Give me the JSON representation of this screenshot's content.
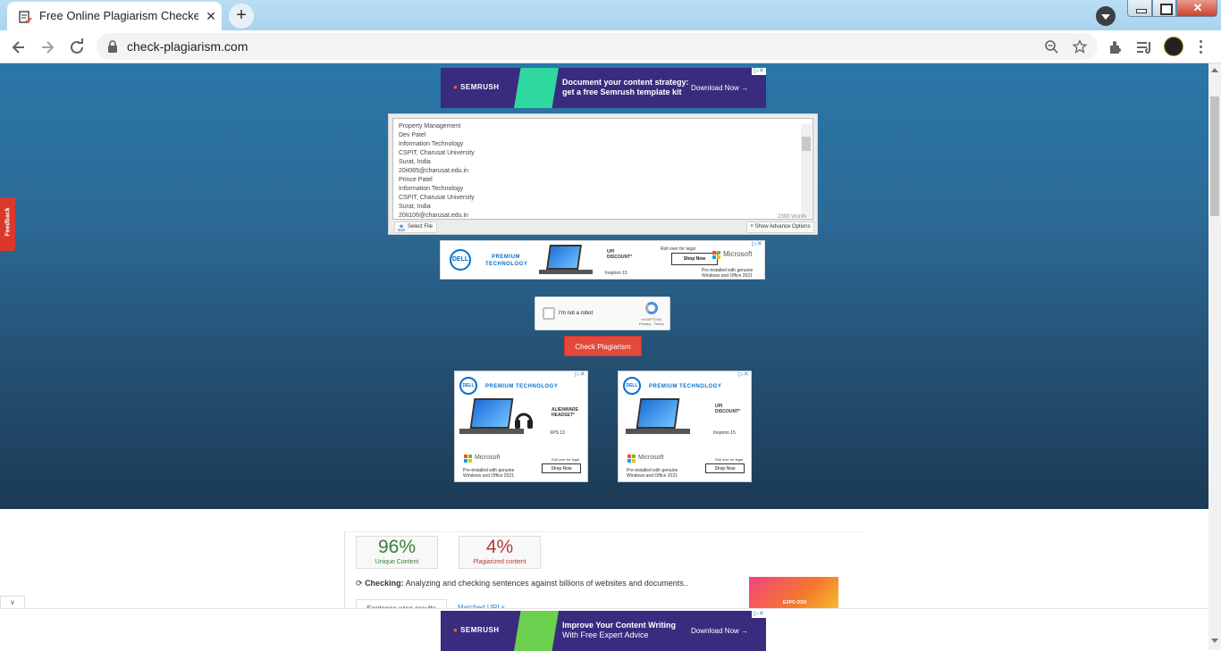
{
  "browser": {
    "tab_title": "Free Online Plagiarism Checker -",
    "tab_close": "✕",
    "new_tab": "+",
    "url": "check-plagiarism.com",
    "window_close": "✕"
  },
  "ads": {
    "semrush_top": {
      "brand": "SEMRUSH",
      "line1": "Document your content strategy:",
      "line2": "get a free Semrush template kit",
      "cta": "Download Now →"
    },
    "dell_leader": {
      "brand": "DELL",
      "headline_1": "PREMIUM",
      "headline_2": "TECHNOLOGY",
      "offer_1": "UPI",
      "offer_2": "DISCOUNT*",
      "model": "Inspiron 15",
      "roll": "Roll over for legal",
      "cta": "Shop Now",
      "ms": "Microsoft",
      "ms_note_1": "Pre-installed with genuine",
      "ms_note_2": "Windows and Office 2021"
    },
    "dell_box_1": {
      "brand": "DELL",
      "headline": "PREMIUM TECHNOLOGY",
      "offer_1": "ALIENWARE",
      "offer_2": "HEADSET*",
      "model": "XPS 13",
      "ms": "Microsoft",
      "roll": "Roll over for legal",
      "cta": "Shop Now",
      "note_1": "Pre-installed with genuine",
      "note_2": "Windows and Office 2021"
    },
    "dell_box_2": {
      "brand": "DELL",
      "headline": "PREMIUM TECHNOLOGY",
      "offer_1": "UPI",
      "offer_2": "DISCOUNT*",
      "model": "Inspiron 15",
      "ms": "Microsoft",
      "roll": "Roll over for legal",
      "cta": "Shop Now",
      "note_1": "Pre-installed with genuine",
      "note_2": "Windows and Office 2021"
    },
    "semrush_bottom": {
      "brand": "SEMRUSH",
      "line1": "Improve Your Content Writing",
      "line2": "With Free Expert Advice",
      "cta": "Download Now →"
    },
    "expo": {
      "label": "EXPO 2020"
    }
  },
  "editor": {
    "lines": [
      "Property Management",
      "Dev Patel",
      "Information Technology",
      "CSPIT, Charusat University",
      "Surat, India",
      "20it085@charusat.edu.in",
      "Prince Patel",
      "Information Technology",
      "CSPIT, Charusat University",
      "Surat, India",
      "20it106@charusat.edu.in"
    ],
    "word_count": "2393 Words",
    "select_file": "Select File",
    "advanced": "Show Advance Options"
  },
  "captcha": {
    "label": "I'm not a robot",
    "brand": "reCAPTCHA",
    "links": "Privacy - Terms"
  },
  "check_button": "Check Plagiarism",
  "feedback": "Feedback",
  "results": {
    "unique_pct": "96%",
    "unique_label": "Unique Content",
    "plag_pct": "4%",
    "plag_label": "Plagiarized content",
    "checking_label": "Checking:",
    "checking_text": "Analyzing and checking sentences against billions of websites and documents..",
    "tab_sentence": "Sentence wise results",
    "tab_matched": "Matched URLs"
  }
}
